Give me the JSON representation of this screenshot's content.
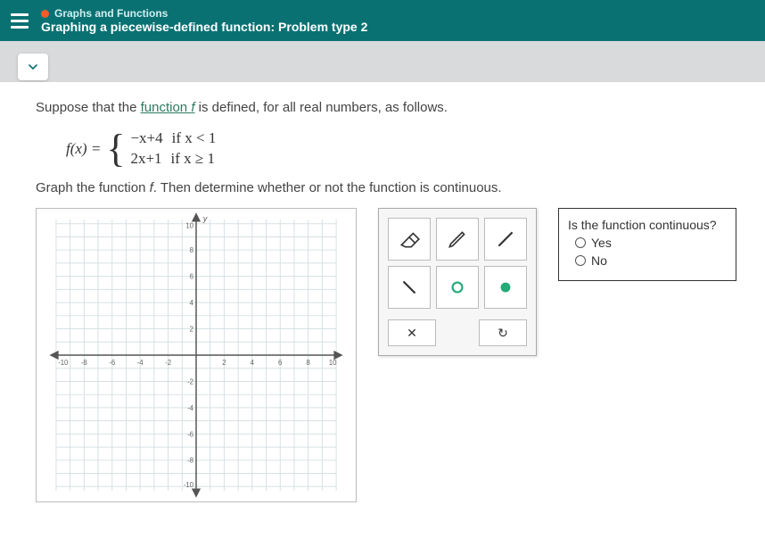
{
  "header": {
    "category": "Graphs and Functions",
    "title": "Graphing a piecewise-defined function: Problem type 2"
  },
  "prompt": {
    "lead": "Suppose that the ",
    "fn_word": "function ",
    "fvar": "f",
    "tail": " is defined, for all real numbers, as follows."
  },
  "piecewise": {
    "lhs": "f(x) =",
    "case1_expr": "−x+4",
    "case1_cond": "if x < 1",
    "case2_expr": "2x+1",
    "case2_cond": "if x ≥ 1"
  },
  "instruction": {
    "a": "Graph the function ",
    "f": "f",
    "b": ". Then determine whether or not the function is continuous."
  },
  "axes": {
    "y_label": "y",
    "ticks_pos": [
      "2",
      "4",
      "6",
      "8",
      "10"
    ],
    "ticks_neg": [
      "-2",
      "-4",
      "-6",
      "-8",
      "-10"
    ],
    "x_neg": [
      "-10",
      "-8",
      "-6",
      "-4",
      "-2"
    ],
    "x_pos": [
      "2",
      "4",
      "6",
      "8",
      "10"
    ]
  },
  "toolbox": {
    "clear": "✕",
    "undo": "↻"
  },
  "question": {
    "text": "Is the function continuous?",
    "yes": "Yes",
    "no": "No"
  }
}
